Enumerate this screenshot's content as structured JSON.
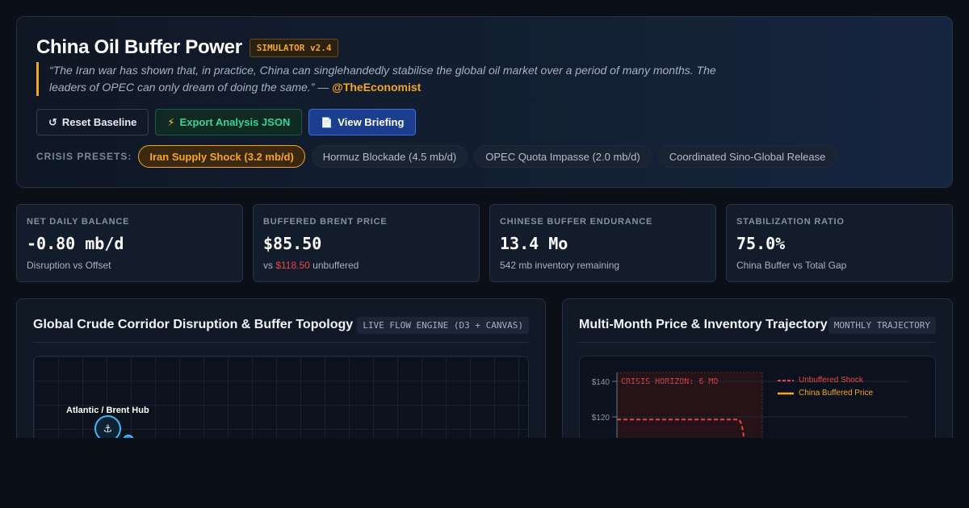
{
  "header": {
    "title": "China Oil Buffer Power",
    "version": "SIMULATOR v2.4",
    "quote_text": "“The Iran war has shown that, in practice, China can singlehandedly stabilise the global oil market over a period of many months. The leaders of OPEC can only dream of doing the same.” — ",
    "quote_handle": "@TheEconomist"
  },
  "actions": {
    "reset_label": "Reset Baseline",
    "reset_icon": "↺",
    "export_label": "Export Analysis JSON",
    "export_icon": "⚡",
    "briefing_label": "View Briefing",
    "briefing_icon": "📄"
  },
  "presets": {
    "label": "CRISIS PRESETS:",
    "items": [
      {
        "label": "Iran Supply Shock (3.2 mb/d)",
        "active": true
      },
      {
        "label": "Hormuz Blockade (4.5 mb/d)",
        "active": false
      },
      {
        "label": "OPEC Quota Impasse (2.0 mb/d)",
        "active": false
      },
      {
        "label": "Coordinated Sino-Global Release",
        "active": false
      }
    ]
  },
  "stats": [
    {
      "label": "NET DAILY BALANCE",
      "value": "-0.80 mb/d",
      "sub": "Disruption vs Offset"
    },
    {
      "label": "BUFFERED BRENT PRICE",
      "value": "$85.50",
      "sub_prefix": "vs ",
      "sub_highlight": "$118.50",
      "sub_suffix": " unbuffered"
    },
    {
      "label": "CHINESE BUFFER ENDURANCE",
      "value": "13.4 Mo",
      "sub": "542 mb inventory remaining"
    },
    {
      "label": "STABILIZATION RATIO",
      "value": "75.0%",
      "sub": "China Buffer vs Total Gap"
    }
  ],
  "flow_panel": {
    "title": "Global Crude Corridor Disruption & Buffer Topology",
    "tag": "LIVE FLOW ENGINE (D3 + CANVAS)",
    "hub_label": "Atlantic / Brent Hub",
    "hub_icon": "⚓"
  },
  "trajectory_panel": {
    "title": "Multi-Month Price & Inventory Trajectory",
    "tag": "MONTHLY TRAJECTORY",
    "crisis_label": "CRISIS HORIZON: 6 MO",
    "legend": [
      "Unbuffered Shock",
      "China Buffered Price"
    ]
  },
  "chart_data": {
    "type": "line",
    "y_ticks": [
      "$140",
      "$120"
    ],
    "y_tick_values": [
      140,
      120
    ],
    "ylim": [
      0,
      145
    ],
    "series": [
      {
        "name": "Unbuffered Shock",
        "values": [
          118.5,
          118.5,
          118.5,
          118.5,
          118.5,
          118.5,
          105
        ]
      },
      {
        "name": "China Buffered Price",
        "values": []
      }
    ],
    "crisis_months": 6,
    "colors": {
      "unbuffered": "#ef4444",
      "buffered": "#f5a524"
    }
  }
}
